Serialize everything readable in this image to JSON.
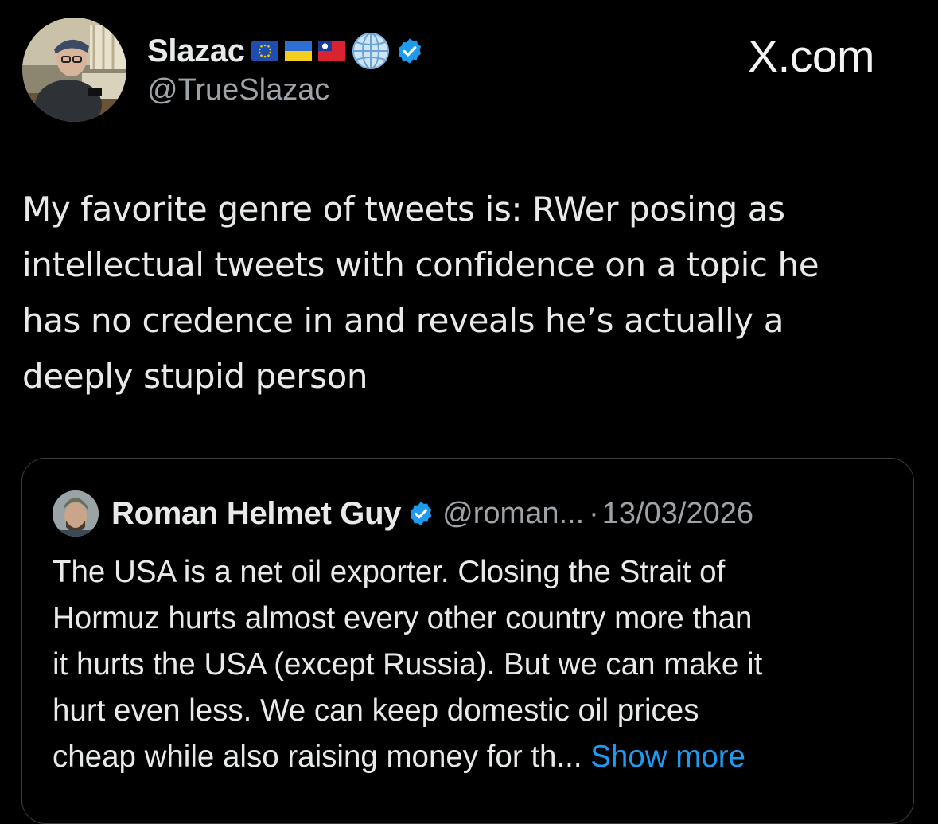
{
  "author": {
    "display_name": "Slazac",
    "handle": "@TrueSlazac",
    "flag_icons": [
      "eu-flag-icon",
      "ukraine-flag-icon",
      "taiwan-flag-icon"
    ],
    "globe_icon": "globe-icon",
    "verified_icon": "verified-badge-icon"
  },
  "watermark": "X.com",
  "tweet": {
    "text": "My favorite genre of tweets is: RWer posing as\nintellectual tweets with confidence on a topic he\nhas no credence in and reveals he’s actually a\ndeeply stupid person"
  },
  "quoted_tweet": {
    "display_name": "Roman Helmet Guy",
    "handle": "@roman...",
    "separator": "·",
    "date": "13/03/2026",
    "text": "The USA is a net oil exporter. Closing the Strait of\nHormuz hurts almost every other country more than\nit hurts the USA (except Russia). But we can make it\nhurt even less. We can keep domestic oil prices\ncheap while also raising money for th...",
    "show_more_label": "Show more"
  },
  "colors": {
    "background": "#000000",
    "text": "#e7e9ea",
    "muted": "#9ea3a8",
    "link": "#1d9bf0",
    "verified": "#1d9bf0",
    "card_border": "#3a3c3f"
  }
}
